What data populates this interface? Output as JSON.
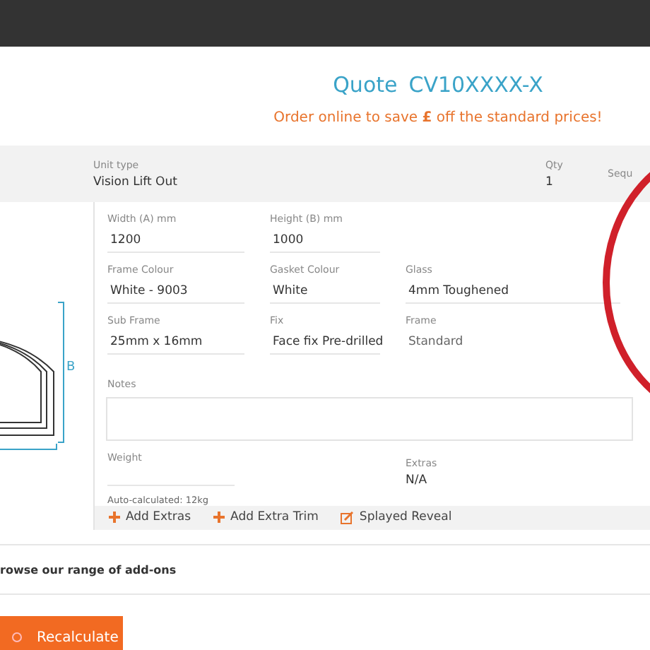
{
  "quote": {
    "label": "Quote",
    "number": "CV10XXXX-X"
  },
  "promo": "Order online to save **£** off the standard prices!",
  "unit": {
    "type_label": "Unit type",
    "type_value": "Vision Lift Out",
    "qty_label": "Qty",
    "qty_value": "1",
    "seq_label": "Sequ"
  },
  "drawing": {
    "dim_label": "B"
  },
  "field_rows": [
    [
      {
        "label": "Width (A) mm",
        "value": "1200",
        "kind": "input"
      },
      {
        "label": "Height (B) mm",
        "value": "1000",
        "kind": "input"
      }
    ],
    [
      {
        "label": "Frame Colour",
        "value": "White - 9003",
        "kind": "input"
      },
      {
        "label": "Gasket Colour",
        "value": "White",
        "kind": "input"
      },
      {
        "label": "Glass",
        "value": "4mm Toughened",
        "kind": "input"
      }
    ],
    [
      {
        "label": "Sub Frame",
        "value": "25mm x 16mm",
        "kind": "input"
      },
      {
        "label": "Fix",
        "value": "Face fix Pre-drilled",
        "kind": "input"
      },
      {
        "label": "Frame",
        "value": "Standard",
        "kind": "static"
      }
    ]
  ],
  "notes": {
    "label": "Notes"
  },
  "weight": {
    "label": "Weight",
    "hint": "Auto-calculated: 12kg"
  },
  "extras": {
    "label": "Extras",
    "value": "N/A"
  },
  "actions": [
    {
      "label": "Add Extras",
      "kind": "add"
    },
    {
      "label": "Add Extra Trim",
      "kind": "add"
    },
    {
      "label": "Splayed Reveal",
      "kind": "edit"
    }
  ],
  "addons": "rowse our range of add-ons",
  "recalculate": "Recalculate"
}
